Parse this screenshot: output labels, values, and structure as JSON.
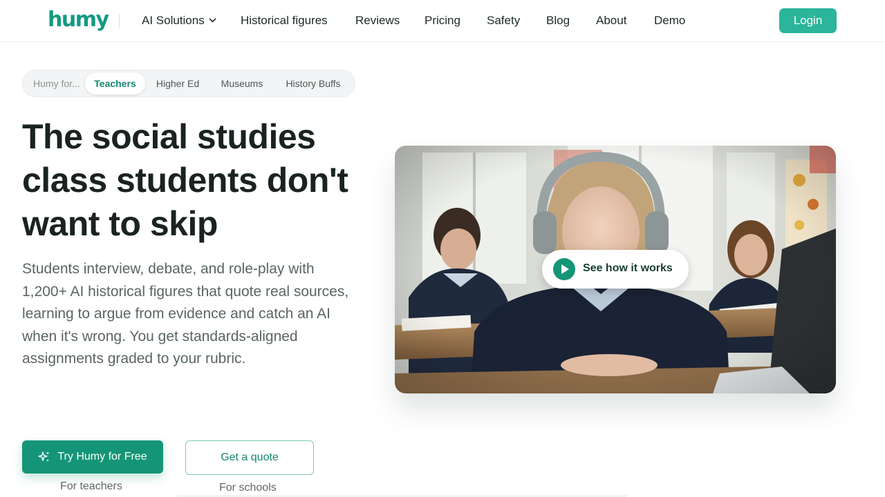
{
  "header": {
    "logo_text": "humy",
    "nav": [
      {
        "label": "AI Solutions",
        "has_dropdown": true
      },
      {
        "label": "Historical figures"
      },
      {
        "label": "Reviews"
      },
      {
        "label": "Pricing"
      },
      {
        "label": "Safety"
      },
      {
        "label": "Blog"
      },
      {
        "label": "About"
      },
      {
        "label": "Demo"
      }
    ],
    "login_label": "Login"
  },
  "audience": {
    "prefix": "Humy for...",
    "items": [
      "Teachers",
      "Higher Ed",
      "Museums",
      "History Buffs"
    ],
    "selected": "Teachers"
  },
  "hero": {
    "title": "The social studies class students don't want to skip",
    "subtitle": "Students interview, debate, and role-play with 1,200+ AI historical figures that quote real sources, learning to argue from evidence and catch an AI when it's wrong. You get standards-aligned assignments graded to your rubric."
  },
  "cta": {
    "primary_label": "Try Humy for Free",
    "primary_note": "For teachers",
    "secondary_label": "Get a quote",
    "secondary_note": "For schools"
  },
  "video": {
    "play_label": "See how it works",
    "icon": "play-icon"
  },
  "colors": {
    "brand": "#149a82",
    "primary_button": "#149577",
    "login_button": "#2bb59a"
  }
}
